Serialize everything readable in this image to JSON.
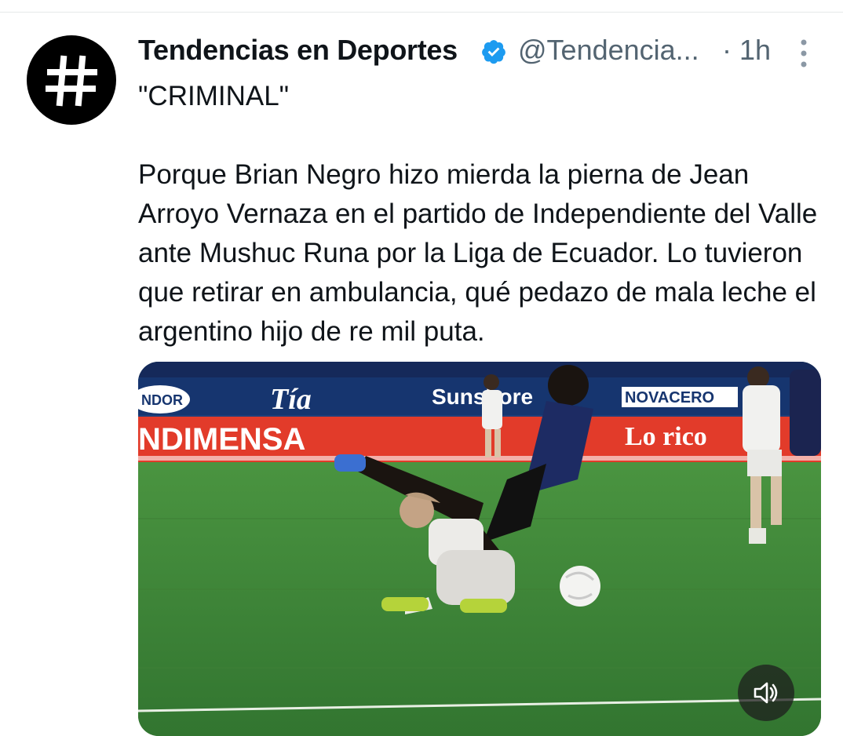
{
  "tweet": {
    "author": {
      "display_name": "Tendencias en Deportes",
      "handle": "@Tendencia...",
      "verified": true,
      "avatar_icon": "hashtag-icon"
    },
    "timestamp": "· 1h",
    "text_lines": [
      "\"CRIMINAL\"",
      "Porque Brian Negro hizo mierda la pierna de Jean Arroyo Vernaza en el partido de Independiente del Valle ante Mushuc Runa por la Liga de Ecuador. Lo tuvieron que retirar en ambulancia, qué pedazo de mala leche el argentino hijo de re mil puta."
    ],
    "media": {
      "type": "video",
      "boards": [
        "NDOR",
        "Tía",
        "Sunshore",
        "NOVACERO",
        "NDIMENSA",
        "Lo rico"
      ],
      "mute_icon": "speaker-icon"
    }
  },
  "colors": {
    "verified_blue": "#1d9bf0",
    "secondary_text": "#536471",
    "pitch_green": "#3f8a3a"
  }
}
